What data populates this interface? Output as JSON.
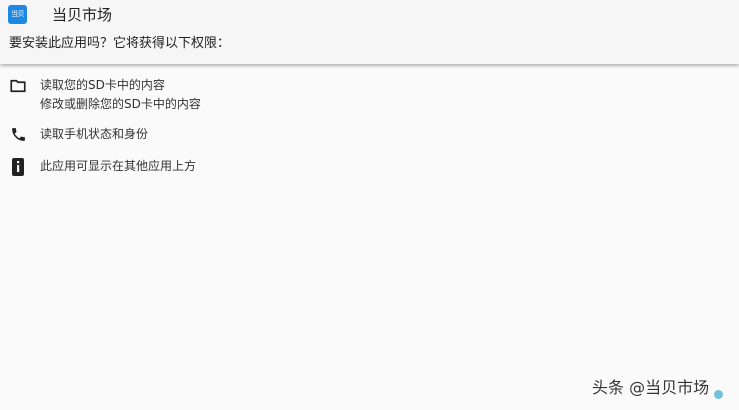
{
  "header": {
    "app_icon_text": "当贝",
    "app_name": "当贝市场",
    "question": "要安装此应用吗？它将获得以下权限："
  },
  "permissions": [
    {
      "icon": "folder-icon",
      "lines": [
        "读取您的SD卡中的内容",
        "修改或删除您的SD卡中的内容"
      ]
    },
    {
      "icon": "phone-icon",
      "lines": [
        "读取手机状态和身份"
      ]
    },
    {
      "icon": "window-info-icon",
      "lines": [
        "此应用可显示在其他应用上方"
      ]
    }
  ],
  "watermark": {
    "text": "头条 @当贝市场"
  },
  "colors": {
    "app_icon_bg": "#1e88e5",
    "background": "#fafafa"
  }
}
